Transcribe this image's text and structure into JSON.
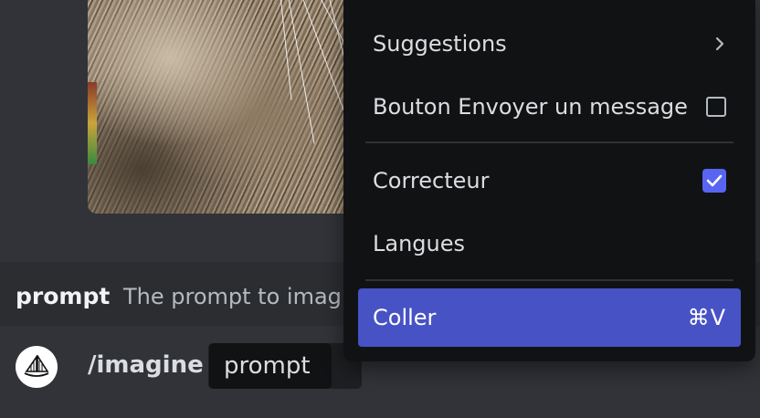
{
  "chat": {
    "prompt_hint": {
      "name": "prompt",
      "description": "The prompt to imagi"
    }
  },
  "command_bar": {
    "command": "/imagine",
    "option_label": "prompt"
  },
  "context_menu": {
    "items": [
      {
        "label": "Suggestions",
        "icon": "chevron-right-icon"
      },
      {
        "label": "Bouton Envoyer un message",
        "checked": false
      },
      {
        "label": "Correcteur",
        "checked": true
      },
      {
        "label": "Langues"
      },
      {
        "label": "Coller",
        "shortcut": "⌘V"
      }
    ]
  },
  "colors": {
    "menu_background": "#111214",
    "highlight": "#4752c4",
    "checkbox_checked": "#5865f2"
  }
}
